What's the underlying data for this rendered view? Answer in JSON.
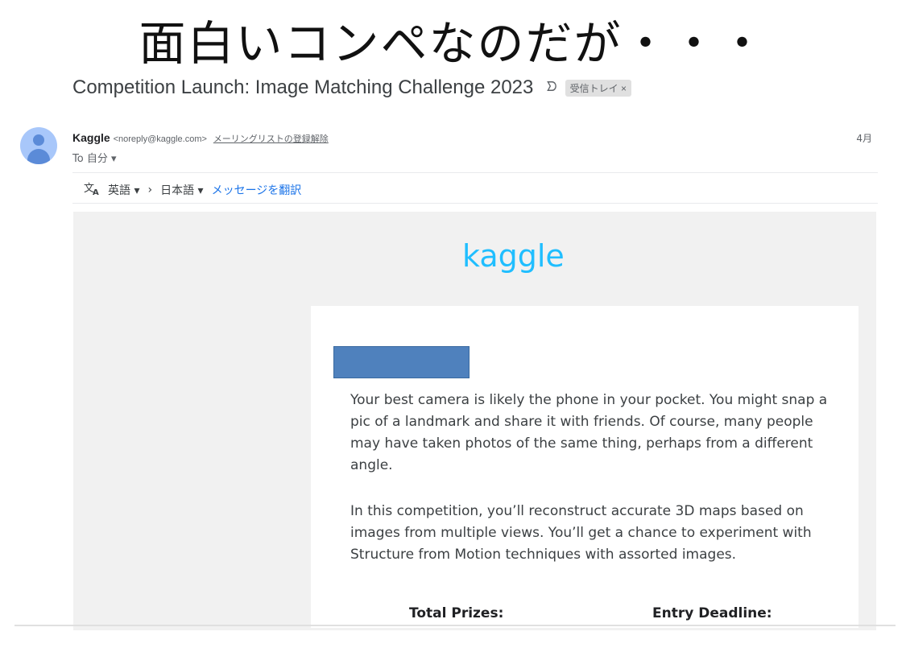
{
  "slide": {
    "title": "面白いコンペなのだが・・・"
  },
  "email": {
    "subject": "Competition Launch: Image Matching Challenge 2023",
    "importance_marker": "ᗤ",
    "label": "受信トレイ ×",
    "sender_name": "Kaggle",
    "sender_address": "<noreply@kaggle.com>",
    "unsubscribe": "メーリングリストの登録解除",
    "to": "To 自分 ▾",
    "date": "4月"
  },
  "translate_bar": {
    "icon": "translate-icon",
    "from_lang": "英語 ▾",
    "arrow": "›",
    "to_lang": "日本語 ▾",
    "action": "メッセージを翻訳"
  },
  "body": {
    "logo": "kaggle",
    "paragraph1": "Your best camera is likely the phone in your pocket. You might snap a pic of a landmark and share it with friends. Of course, many people may have taken photos of the same thing, perhaps from a different angle.",
    "paragraph2": "In this competition, you’ll reconstruct accurate 3D maps based on images from multiple views. You’ll get a chance to experiment with Structure from Motion techniques with assorted images.",
    "total_prizes_label": "Total Prizes:",
    "entry_deadline_label": "Entry Deadline:"
  },
  "colors": {
    "kaggle_blue": "#20beff",
    "redaction_box": "#4f81bd",
    "link_blue": "#1a73e8"
  }
}
